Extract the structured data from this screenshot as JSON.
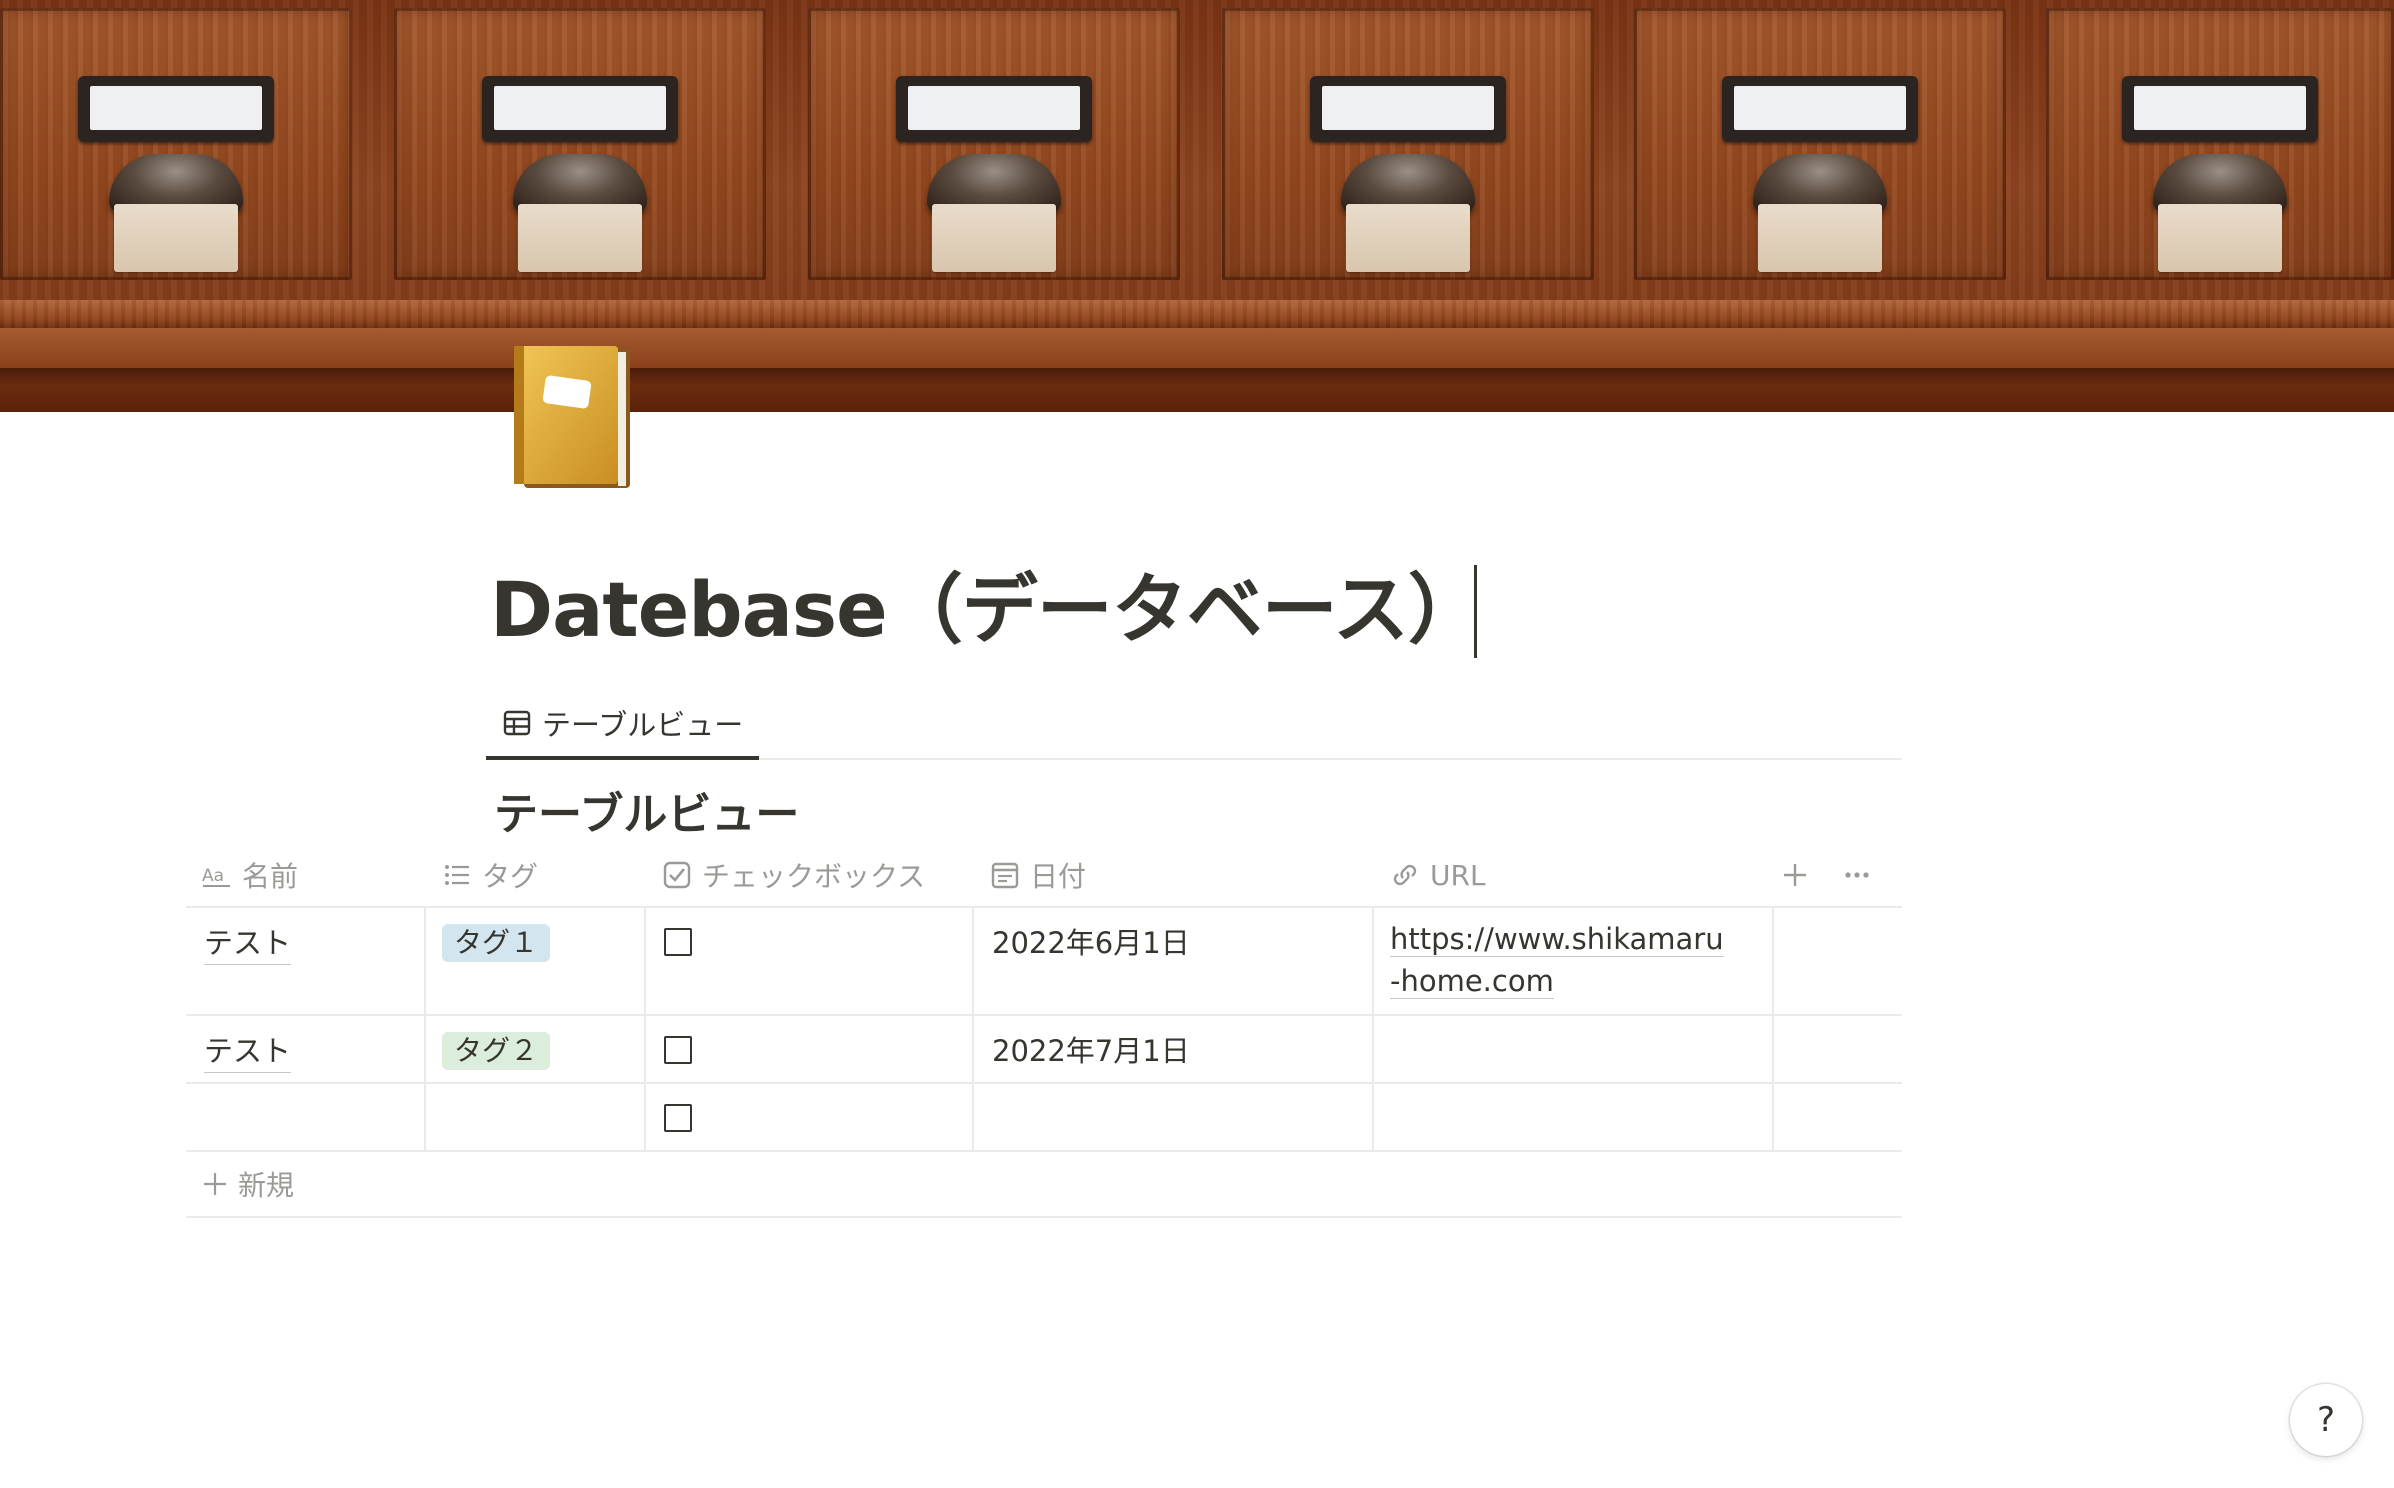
{
  "page": {
    "title": "Datebase（データベース）",
    "cover": "wooden-card-catalog-drawers",
    "icon": "notebook-icon"
  },
  "views": {
    "tabs": [
      {
        "label": "テーブルビュー",
        "icon": "table-icon",
        "active": true
      }
    ],
    "current_heading": "テーブルビュー"
  },
  "table": {
    "columns": [
      {
        "label": "名前",
        "icon": "text-aa-icon"
      },
      {
        "label": "タグ",
        "icon": "list-icon"
      },
      {
        "label": "チェックボックス",
        "icon": "checkbox-icon"
      },
      {
        "label": "日付",
        "icon": "calendar-icon"
      },
      {
        "label": "URL",
        "icon": "link-icon"
      }
    ],
    "rows": [
      {
        "name": "テスト",
        "tag": "タグ１",
        "tag_color": "#d3e5ef",
        "checked": false,
        "date": "2022年6月1日",
        "url": "https://www.shikamaru-home.com"
      },
      {
        "name": "テスト",
        "tag": "タグ２",
        "tag_color": "#dbeddb",
        "checked": false,
        "date": "2022年7月1日",
        "url": ""
      },
      {
        "name": "",
        "tag": "",
        "checked": false,
        "date": "",
        "url": ""
      }
    ],
    "new_row_label": "新規",
    "add_column_icon": "plus-icon",
    "more_icon": "ellipsis-icon"
  },
  "help": {
    "label": "?"
  },
  "colors": {
    "text": "#37352f",
    "muted": "#9b9a97",
    "divider": "#ebeae8"
  }
}
